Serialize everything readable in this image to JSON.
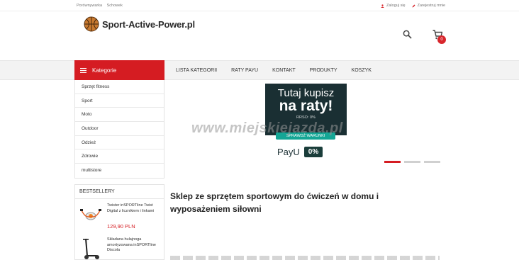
{
  "topbar": {
    "left_links": [
      "Porównywarka",
      "Schowek"
    ],
    "login": "Zaloguj się",
    "register": "Zarejestruj mnie"
  },
  "header": {
    "logo_text": "Sport-Active-Power.pl",
    "cart_count": "0"
  },
  "nav": {
    "categories_label": "Kategorie",
    "links": [
      "LISTA KATEGORII",
      "RATY PAYU",
      "KONTAKT",
      "PRODUKTY",
      "KOSZYK"
    ]
  },
  "sidebar": {
    "categories": [
      "Sprzęt fitness",
      "Sport",
      "Moto",
      "Outdoor",
      "Odzież",
      "Zdrowie",
      "multistore"
    ]
  },
  "banner": {
    "line1": "Tutaj kupisz",
    "line2": "na raty!",
    "rrso": "RRSO: 0%",
    "button": "SPRAWDŹ WARUNKI",
    "payu": "PayU",
    "percent": "0%",
    "watermark": "www.miejskiejazda.pl",
    "slide_count": 3,
    "active_slide": 1
  },
  "bestsellers": {
    "title": "BESTSELLERY",
    "items": [
      {
        "name": "Twister inSPORTline Twist Digital z licznikiem i linkami",
        "price": "129,90 PLN"
      },
      {
        "name": "Składana hulajnoga amortyzowana inSPORTline Discola",
        "price": ""
      }
    ]
  },
  "main": {
    "heading": "Sklep ze sprzętem sportowym do ćwiczeń w domu i wyposażeniem siłowni"
  },
  "colors": {
    "accent": "#d51c22",
    "banner_bg": "#1a2f33",
    "teal": "#14a695"
  }
}
